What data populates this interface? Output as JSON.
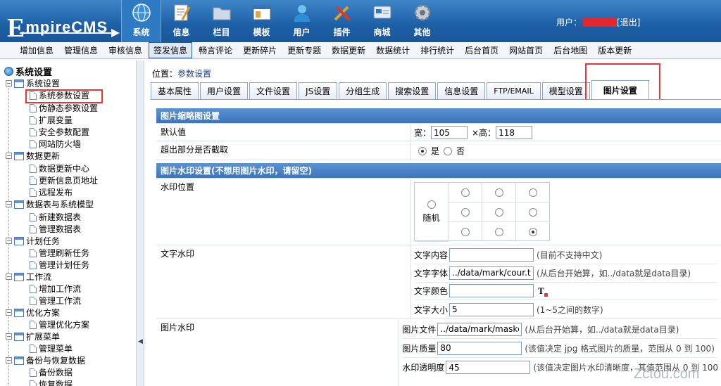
{
  "logo": {
    "text_big": "E",
    "text_rest": "mpireCMS"
  },
  "main_nav": [
    {
      "label": "系统",
      "icon": "globe-icon",
      "active": true
    },
    {
      "label": "信息",
      "icon": "document-pencil-icon"
    },
    {
      "label": "栏目",
      "icon": "folder-icon"
    },
    {
      "label": "模板",
      "icon": "window-template-icon"
    },
    {
      "label": "用户",
      "icon": "user-icon"
    },
    {
      "label": "插件",
      "icon": "tools-icon"
    },
    {
      "label": "商城",
      "icon": "card-icon"
    },
    {
      "label": "其他",
      "icon": "gear-icon"
    }
  ],
  "user": {
    "label": "用户：",
    "logout": "[退出]"
  },
  "sub_nav": [
    "增加信息",
    "管理信息",
    "审核信息",
    "签发信息",
    "畅言评论",
    "更新碎片",
    "更新专题",
    "数据更新",
    "数据统计",
    "排行统计",
    "后台首页",
    "网站首页",
    "后台地图",
    "版本更新"
  ],
  "sub_nav_active": 3,
  "sidebar": {
    "root": "系统设置",
    "groups": [
      {
        "label": "系统设置",
        "items": [
          "系统参数设置",
          "伪静态参数设置",
          "扩展变量",
          "安全参数配置",
          "网站防火墙"
        ]
      },
      {
        "label": "数据更新",
        "items": [
          "数据更新中心",
          "更新信息页地址",
          "远程发布"
        ]
      },
      {
        "label": "数据表与系统模型",
        "items": [
          "新建数据表",
          "管理数据表"
        ]
      },
      {
        "label": "计划任务",
        "items": [
          "管理刷新任务",
          "管理计划任务"
        ]
      },
      {
        "label": "工作流",
        "items": [
          "增加工作流",
          "管理工作流"
        ]
      },
      {
        "label": "优化方案",
        "items": [
          "管理优化方案"
        ]
      },
      {
        "label": "扩展菜单",
        "items": [
          "管理菜单"
        ]
      },
      {
        "label": "备份与恢复数据",
        "items": [
          "备份数据",
          "恢复数据"
        ]
      }
    ]
  },
  "location": {
    "label": "位置：",
    "link": "参数设置"
  },
  "tabs": [
    "基本属性",
    "用户设置",
    "文件设置",
    "JS设置",
    "分组生成",
    "搜索设置",
    "信息设置",
    "FTP/EMAIL",
    "模型设置",
    "图片设置"
  ],
  "active_tab": 9,
  "thumb": {
    "header": "图片缩略图设置",
    "default_label": "默认值",
    "width_label": "宽：",
    "width": "105",
    "height_label": "×高：",
    "height": "118",
    "crop_label": "超出部分是否截取",
    "yes": "是",
    "no": "否"
  },
  "watermark": {
    "header": "图片水印设置(不想用图片水印，请留空)",
    "position_label": "水印位置",
    "random": "随机",
    "text_label": "文字水印",
    "text_content_label": "文字内容",
    "text_content": "",
    "text_content_hint": "(目前不支持中文)",
    "text_font_label": "文字字体",
    "text_font": "../data/mark/cour.ttf",
    "text_font_hint": "(从后台开始算，如../data就是data目录)",
    "text_color_label": "文字颜色",
    "text_color": "",
    "text_size_label": "文字大小",
    "text_size": "5",
    "text_size_hint": "(1~5之间的数字)",
    "image_label": "图片水印",
    "image_file_label": "图片文件",
    "image_file": "../data/mark/maskdef.gif",
    "image_file_hint": "(从后台开始算，如../data就是data目录)",
    "quality_label": "图片质量",
    "quality": "80",
    "quality_hint": "(该值决定 jpg 格式图片的质量，范围从 0 到 100)",
    "opacity_label": "水印透明度",
    "opacity": "45",
    "opacity_hint": "(该值决定图片水印清晰度，其值范围从 0 到 100"
  },
  "site_watermark": "Zctou.com"
}
